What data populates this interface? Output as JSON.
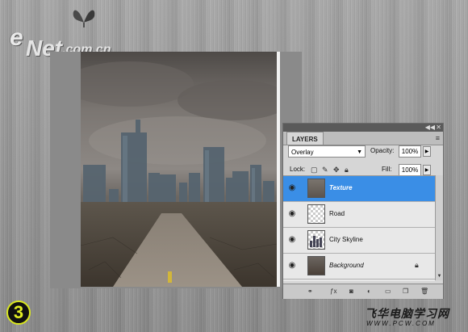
{
  "site_logo": {
    "letter": "e",
    "word": "Net",
    "domain": ".com.cn"
  },
  "step_badge": {
    "number": "3",
    "accent_color": "#e3ef24"
  },
  "watermark": {
    "chinese_text": "飞华电脑学习网",
    "url_text": "WWW.PCW.COM"
  },
  "layers_panel": {
    "tab_label": "LAYERS",
    "blend_mode": "Overlay",
    "opacity_label": "Opacity:",
    "opacity_value": "100%",
    "lock_label": "Lock:",
    "fill_label": "Fill:",
    "fill_value": "100%",
    "layers": [
      {
        "name": "Texture",
        "selected": true,
        "visible": true
      },
      {
        "name": "Road",
        "selected": false,
        "visible": true
      },
      {
        "name": "City Skyline",
        "selected": false,
        "visible": true
      },
      {
        "name": "Background",
        "selected": false,
        "visible": true,
        "locked": true
      }
    ],
    "selection_color": "#3a8ee6"
  },
  "icons": {
    "eye": "eye-icon",
    "lock": "lock-icon",
    "menu": "panel-menu-icon",
    "collapse": "double-arrow-icon"
  }
}
